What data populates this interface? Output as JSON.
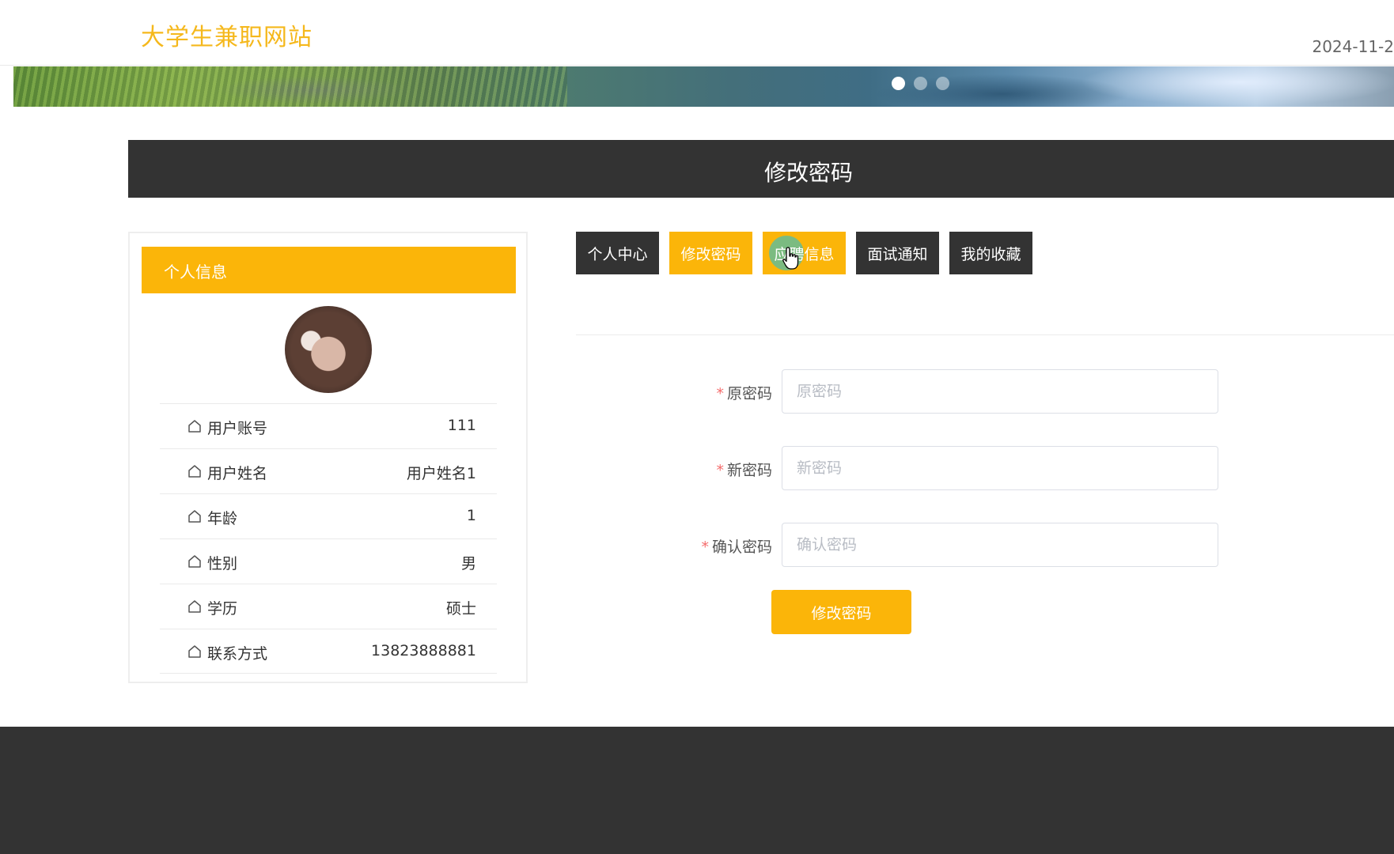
{
  "site": {
    "title": "大学生兼职网站",
    "date": "2024-11-2"
  },
  "banner": {
    "slides": 3,
    "active_slide": 1
  },
  "page_header": {
    "title": "修改密码"
  },
  "profile": {
    "heading": "个人信息",
    "rows": [
      {
        "label": "用户账号",
        "value": "111"
      },
      {
        "label": "用户姓名",
        "value": "用户姓名1"
      },
      {
        "label": "年龄",
        "value": "1"
      },
      {
        "label": "性别",
        "value": "男"
      },
      {
        "label": "学历",
        "value": "硕士"
      },
      {
        "label": "联系方式",
        "value": "13823888881"
      }
    ]
  },
  "tabs": [
    {
      "label": "个人中心",
      "active": false
    },
    {
      "label": "修改密码",
      "active": true
    },
    {
      "label": "应聘信息",
      "active": true
    },
    {
      "label": "面试通知",
      "active": false
    },
    {
      "label": "我的收藏",
      "active": false
    }
  ],
  "form": {
    "old_password": {
      "label": "原密码",
      "placeholder": "原密码"
    },
    "new_password": {
      "label": "新密码",
      "placeholder": "新密码"
    },
    "confirm_password": {
      "label": "确认密码",
      "placeholder": "确认密码"
    },
    "required_mark": "*",
    "submit_label": "修改密码"
  },
  "colors": {
    "accent": "#fbb509",
    "dark": "#333333",
    "title": "#f5b81c",
    "required": "#f56c6c"
  }
}
